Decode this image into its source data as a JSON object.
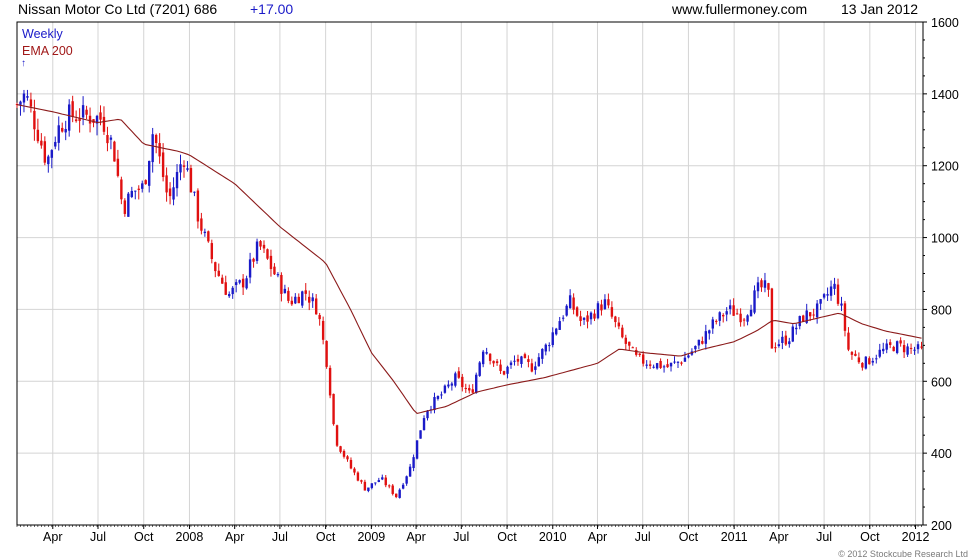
{
  "header": {
    "title": "Nissan Motor Co Ltd (7201) 686",
    "change": "+17.00",
    "website": "www.fullermoney.com",
    "date": "13 Jan 2012"
  },
  "indicators": {
    "period": "Weekly",
    "ema": "EMA 200",
    "arrow": "↑"
  },
  "footer": {
    "copyright": "© 2012 Stockcube Research Ltd"
  },
  "colors": {
    "up": "#1a1ac8",
    "down": "#e01010",
    "ema": "#8b1a1a",
    "grid": "#d4d4d4"
  },
  "chart_data": {
    "type": "candlestick",
    "grid": true,
    "ylim": [
      200,
      1600
    ],
    "yticks": [
      200,
      400,
      600,
      800,
      1000,
      1200,
      1400,
      1600
    ],
    "xlim": [
      "2007-01-19",
      "2012-01-16"
    ],
    "xticks": [
      {
        "label": "Apr",
        "date": "2007-04-01"
      },
      {
        "label": "Jul",
        "date": "2007-07-01"
      },
      {
        "label": "Oct",
        "date": "2007-10-01"
      },
      {
        "label": "2008",
        "date": "2008-01-01"
      },
      {
        "label": "Apr",
        "date": "2008-04-01"
      },
      {
        "label": "Jul",
        "date": "2008-07-01"
      },
      {
        "label": "Oct",
        "date": "2008-10-01"
      },
      {
        "label": "2009",
        "date": "2009-01-01"
      },
      {
        "label": "Apr",
        "date": "2009-04-01"
      },
      {
        "label": "Jul",
        "date": "2009-07-01"
      },
      {
        "label": "Oct",
        "date": "2009-10-01"
      },
      {
        "label": "2010",
        "date": "2010-01-01"
      },
      {
        "label": "Apr",
        "date": "2010-04-01"
      },
      {
        "label": "Jul",
        "date": "2010-07-01"
      },
      {
        "label": "Oct",
        "date": "2010-10-01"
      },
      {
        "label": "2011",
        "date": "2011-01-01"
      },
      {
        "label": "Apr",
        "date": "2011-04-01"
      },
      {
        "label": "Jul",
        "date": "2011-07-01"
      },
      {
        "label": "Oct",
        "date": "2011-10-01"
      },
      {
        "label": "2012",
        "date": "2012-01-01"
      }
    ],
    "price_path": [
      [
        "2007-01-19",
        1370
      ],
      [
        "2007-02-05",
        1400
      ],
      [
        "2007-03-05",
        1280
      ],
      [
        "2007-03-20",
        1210
      ],
      [
        "2007-04-10",
        1300
      ],
      [
        "2007-05-01",
        1340
      ],
      [
        "2007-06-01",
        1340
      ],
      [
        "2007-07-10",
        1330
      ],
      [
        "2007-08-01",
        1250
      ],
      [
        "2007-08-20",
        1080
      ],
      [
        "2007-09-10",
        1130
      ],
      [
        "2007-10-01",
        1140
      ],
      [
        "2007-10-20",
        1300
      ],
      [
        "2007-11-20",
        1100
      ],
      [
        "2007-12-20",
        1230
      ],
      [
        "2008-01-20",
        1050
      ],
      [
        "2008-02-20",
        920
      ],
      [
        "2008-03-20",
        840
      ],
      [
        "2008-04-20",
        880
      ],
      [
        "2008-05-20",
        980
      ],
      [
        "2008-06-20",
        900
      ],
      [
        "2008-07-20",
        820
      ],
      [
        "2008-08-20",
        850
      ],
      [
        "2008-09-15",
        800
      ],
      [
        "2008-10-05",
        640
      ],
      [
        "2008-10-20",
        440
      ],
      [
        "2008-11-20",
        360
      ],
      [
        "2008-12-20",
        300
      ],
      [
        "2009-01-20",
        330
      ],
      [
        "2009-02-20",
        280
      ],
      [
        "2009-03-20",
        360
      ],
      [
        "2009-04-20",
        520
      ],
      [
        "2009-05-20",
        560
      ],
      [
        "2009-06-20",
        610
      ],
      [
        "2009-07-20",
        560
      ],
      [
        "2009-08-15",
        700
      ],
      [
        "2009-09-20",
        620
      ],
      [
        "2009-10-20",
        660
      ],
      [
        "2009-11-20",
        640
      ],
      [
        "2009-12-20",
        700
      ],
      [
        "2010-01-10",
        760
      ],
      [
        "2010-02-05",
        820
      ],
      [
        "2010-03-01",
        760
      ],
      [
        "2010-04-15",
        820
      ],
      [
        "2010-05-20",
        720
      ],
      [
        "2010-06-20",
        660
      ],
      [
        "2010-07-20",
        650
      ],
      [
        "2010-08-20",
        640
      ],
      [
        "2010-09-20",
        660
      ],
      [
        "2010-10-20",
        700
      ],
      [
        "2010-11-20",
        760
      ],
      [
        "2010-12-20",
        800
      ],
      [
        "2011-01-20",
        780
      ],
      [
        "2011-02-20",
        860
      ],
      [
        "2011-03-10",
        860
      ],
      [
        "2011-03-18",
        700
      ],
      [
        "2011-04-20",
        720
      ],
      [
        "2011-05-20",
        780
      ],
      [
        "2011-06-20",
        800
      ],
      [
        "2011-07-20",
        870
      ],
      [
        "2011-08-05",
        800
      ],
      [
        "2011-08-20",
        680
      ],
      [
        "2011-09-20",
        650
      ],
      [
        "2011-10-20",
        680
      ],
      [
        "2011-11-20",
        700
      ],
      [
        "2011-12-20",
        690
      ],
      [
        "2012-01-13",
        686
      ]
    ],
    "ema_path": [
      [
        "2007-01-19",
        1370
      ],
      [
        "2007-04-01",
        1350
      ],
      [
        "2007-07-01",
        1320
      ],
      [
        "2007-08-15",
        1330
      ],
      [
        "2007-10-01",
        1260
      ],
      [
        "2007-12-10",
        1240
      ],
      [
        "2008-01-01",
        1230
      ],
      [
        "2008-04-01",
        1150
      ],
      [
        "2008-07-01",
        1030
      ],
      [
        "2008-10-01",
        930
      ],
      [
        "2008-11-20",
        800
      ],
      [
        "2009-01-01",
        680
      ],
      [
        "2009-02-15",
        600
      ],
      [
        "2009-04-01",
        510
      ],
      [
        "2009-06-01",
        530
      ],
      [
        "2009-08-01",
        570
      ],
      [
        "2009-10-01",
        590
      ],
      [
        "2009-12-15",
        610
      ],
      [
        "2010-04-01",
        650
      ],
      [
        "2010-05-15",
        690
      ],
      [
        "2010-07-01",
        680
      ],
      [
        "2010-09-15",
        670
      ],
      [
        "2010-11-01",
        690
      ],
      [
        "2011-01-01",
        710
      ],
      [
        "2011-02-15",
        740
      ],
      [
        "2011-03-20",
        770
      ],
      [
        "2011-05-01",
        760
      ],
      [
        "2011-07-01",
        780
      ],
      [
        "2011-08-01",
        790
      ],
      [
        "2011-09-15",
        760
      ],
      [
        "2011-11-01",
        740
      ],
      [
        "2012-01-13",
        720
      ]
    ]
  }
}
